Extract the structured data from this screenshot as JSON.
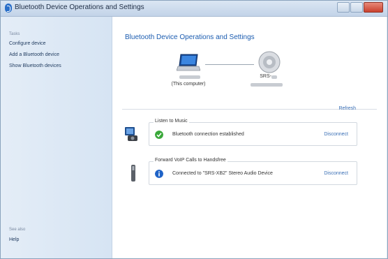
{
  "window": {
    "title": "Bluetooth Device Operations and Settings"
  },
  "sidebar": {
    "tasks_heading": "Tasks",
    "items": [
      {
        "label": "Configure device"
      },
      {
        "label": "Add a Bluetooth device"
      },
      {
        "label": "Show Bluetooth devices"
      }
    ],
    "see_also_heading": "See also",
    "help_label": "Help"
  },
  "main": {
    "title": "Bluetooth Device Operations and Settings",
    "computer_caption": "(This computer)",
    "remote_device_name": "SRS-",
    "refresh_label": "Refresh",
    "services": [
      {
        "group_label": "Listen to Music",
        "status_text": "Bluetooth connection established",
        "status_icon": "check-icon",
        "action_label": "Disconnect"
      },
      {
        "group_label": "Forward VoIP Calls to Handsfree",
        "status_text": "Connected to \"SRS-XB2\" Stereo Audio Device",
        "status_icon": "info-icon",
        "action_label": "Disconnect"
      }
    ]
  },
  "colors": {
    "accent": "#1b5cb0",
    "link": "#3a6fb5",
    "sidebar_bg": "#dbe6f3",
    "success": "#3aa83a",
    "info": "#1f63c7"
  }
}
